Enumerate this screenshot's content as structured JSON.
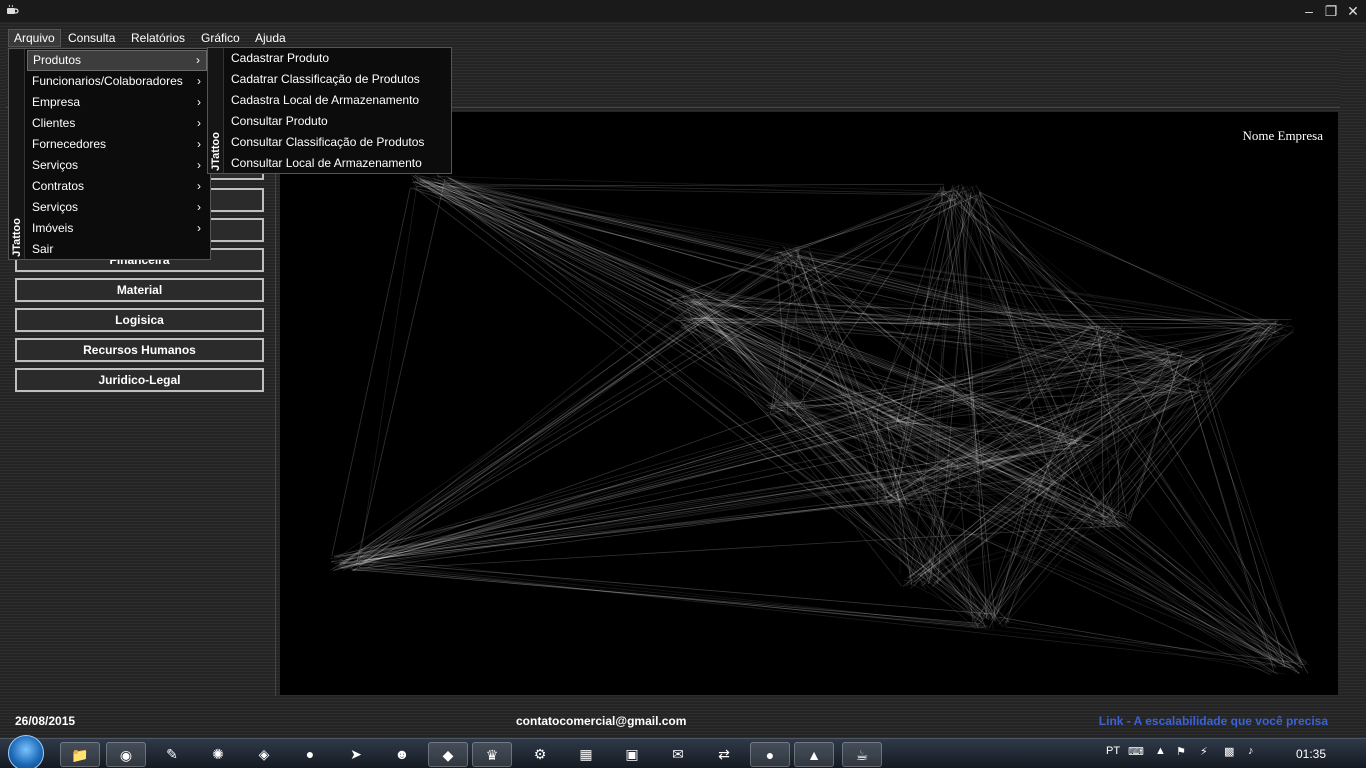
{
  "window": {
    "minimize_icon": "minimize-icon",
    "maximize_icon": "maximize-icon",
    "close_icon": "close-icon"
  },
  "menubar": {
    "items": [
      "Arquivo",
      "Consulta",
      "Relatórios",
      "Gráfico",
      "Ajuda"
    ],
    "active": "Arquivo"
  },
  "arquivo_menu": {
    "brand": "JTattoo",
    "items": [
      {
        "label": "Produtos",
        "submenu": true
      },
      {
        "label": "Funcionarios/Colaboradores",
        "submenu": true
      },
      {
        "label": "Empresa",
        "submenu": true
      },
      {
        "label": "Clientes",
        "submenu": true
      },
      {
        "label": "Fornecedores",
        "submenu": true
      },
      {
        "label": "Serviços",
        "submenu": true
      },
      {
        "label": "Contratos",
        "submenu": true
      },
      {
        "label": "Serviços",
        "submenu": true
      },
      {
        "label": "Imóveis",
        "submenu": true
      },
      {
        "label": "Sair",
        "submenu": false
      }
    ],
    "selected": "Produtos"
  },
  "produtos_menu": {
    "brand": "JTattoo",
    "items": [
      "Cadastrar Produto",
      "Cadatrar Classificação de Produtos",
      "Cadastra Local de Armazenamento",
      "Consultar Produto",
      "Consultar Classificação de Produtos",
      "Consultar Local de Armazenamento"
    ]
  },
  "side_buttons": {
    "partial": "Financeira",
    "labels": [
      "Material",
      "Logisica",
      "Recursos Humanos",
      "Juridico-Legal"
    ]
  },
  "canvas": {
    "company_name": "Nome Empresa"
  },
  "status": {
    "date": "26/08/2015",
    "email": "contatocomercial@gmail.com",
    "link": "Link - A escalabilidade que você precisa",
    "link_color": "#3a63d6"
  },
  "taskbar": {
    "lang": "PT",
    "clock": "01:35",
    "apps": [
      "folder-icon",
      "chrome-icon",
      "notepad-icon",
      "app-icon",
      "paint-icon",
      "eclipse-icon",
      "app-icon",
      "app-icon",
      "git-icon",
      "postgres-icon",
      "app-icon",
      "server-icon",
      "virtualbox-icon",
      "app-icon",
      "teamviewer-icon",
      "eclipse-icon",
      "app-icon",
      "java-icon"
    ]
  }
}
